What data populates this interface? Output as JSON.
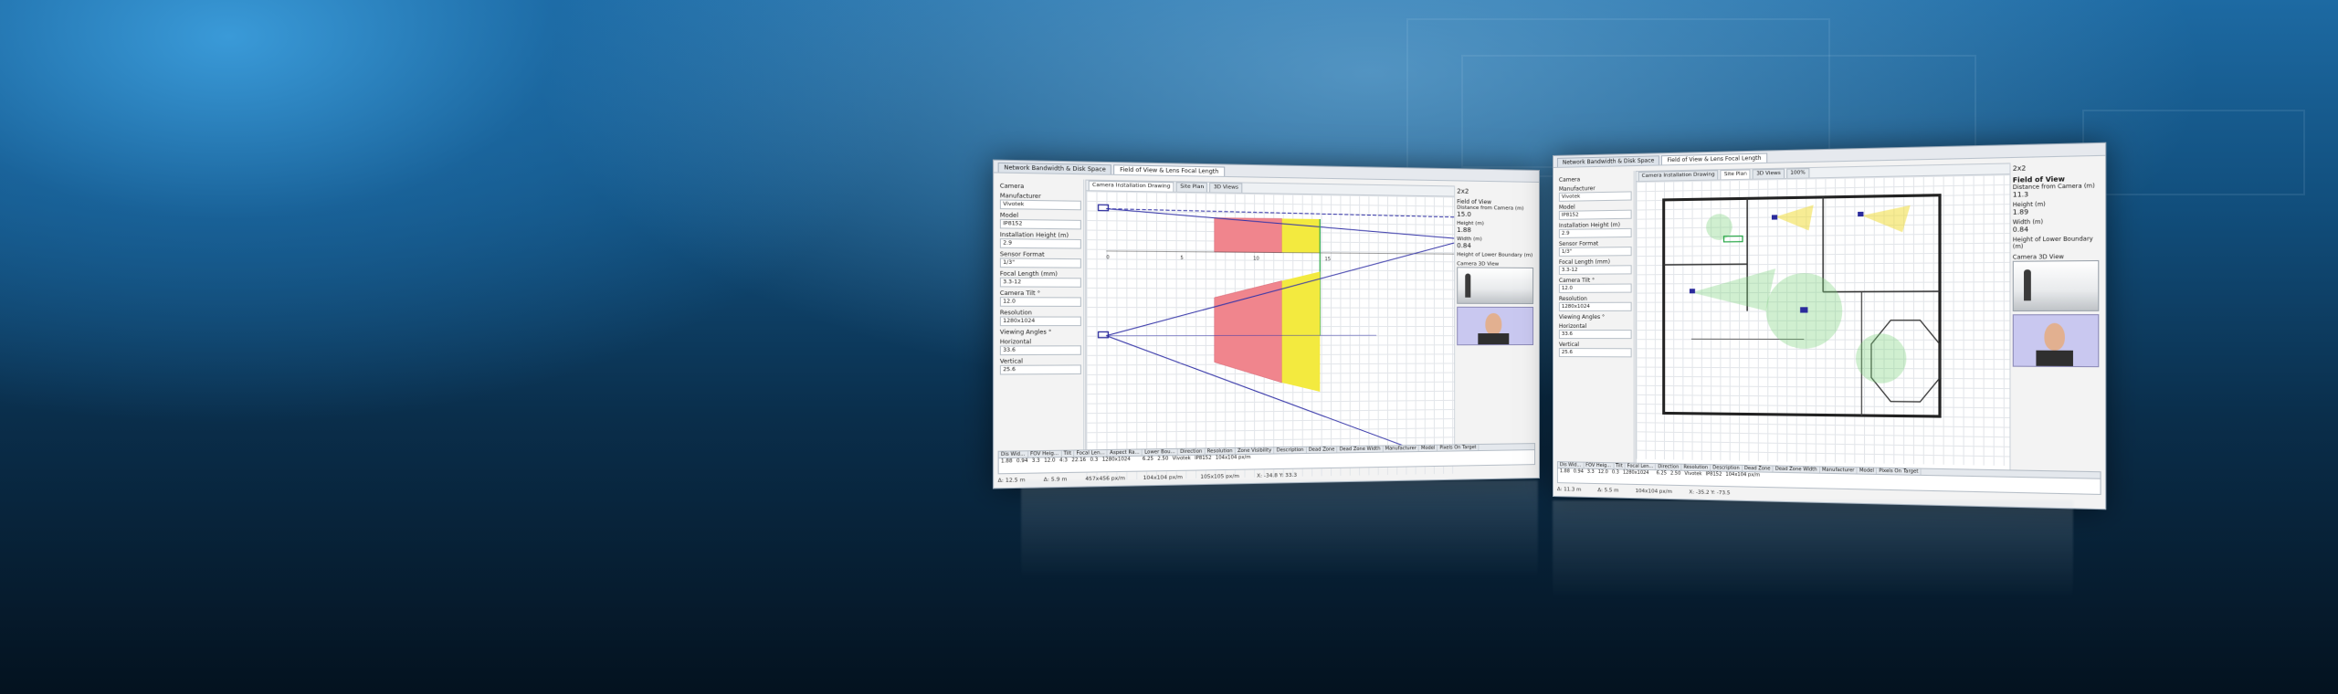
{
  "left_window": {
    "tabs": [
      "Network Bandwidth & Disk Space",
      "Field of View & Lens Focal Length"
    ],
    "subtabs": [
      "Camera Installation Drawing",
      "Site Plan",
      "3D Views"
    ],
    "side_labels": [
      "Camera",
      "Manufacturer",
      "Model",
      "Installation Height (m)",
      "Sensor Format",
      "Focal Length (mm)",
      "Camera Tilt °",
      "Resolution",
      "Viewing Angles °",
      "Horizontal",
      "Vertical"
    ],
    "side_values": [
      "Vivotek",
      "IP8152",
      "2.9",
      "1/3\"",
      "3.3-12",
      "12.0",
      "1280x1024",
      "33.6",
      "25.6"
    ],
    "right_labels": [
      "Field of View",
      "Distance from Camera (m)",
      "Height (m)",
      "Width (m)",
      "Height of Lower Boundary (m)",
      "Camera 3D View"
    ],
    "right_values": [
      "2x2",
      "15.0",
      "1.88",
      "0.84"
    ],
    "axis_ticks": [
      "0",
      "5",
      "10",
      "15"
    ],
    "table_headers": [
      "Dis Wid...",
      "FOV Heig...",
      "Tilt",
      "Focal Len...",
      "Aspect Ra...",
      "Lower Bou...",
      "Direction",
      "Resolution",
      "Zone Visibility",
      "Description",
      "Dead Zone",
      "Dead Zone Width",
      "Manufacturer",
      "Model",
      "Pixels On Target"
    ],
    "table_values": [
      "1.88",
      "0.94",
      "3.3",
      "12.0",
      "4:3",
      "22.16",
      "0.3",
      "1280x1024",
      "",
      "",
      "6.25",
      "2.50",
      "Vivotek",
      "IP8152",
      "104x104 px/m"
    ],
    "status": [
      "Δ: 12.5 m",
      "Δ: 5.9 m",
      "457x456 px/m",
      "104x104 px/m",
      "105x105 px/m",
      "X: -34.8 Y: 33.3"
    ]
  },
  "right_window": {
    "tabs": [
      "Network Bandwidth & Disk Space",
      "Field of View & Lens Focal Length"
    ],
    "subtabs": [
      "Camera Installation Drawing",
      "Site Plan",
      "3D Views"
    ],
    "toolbar_zoom": "100%",
    "side_labels": [
      "Camera",
      "Manufacturer",
      "Model",
      "Installation Height (m)",
      "Sensor Format",
      "Focal Length (mm)",
      "Camera Tilt °",
      "Resolution",
      "Viewing Angles °",
      "Horizontal",
      "Vertical"
    ],
    "side_values": [
      "Vivotek",
      "IP8152",
      "2.9",
      "1/3\"",
      "3.3-12",
      "12.0",
      "1280x1024",
      "33.6",
      "25.6"
    ],
    "right_header": "2x2",
    "right_labels": [
      "Field of View",
      "Distance from Camera (m)",
      "Height (m)",
      "Width (m)",
      "Height of Lower Boundary (m)",
      "Camera 3D View"
    ],
    "right_values": [
      "11.3",
      "1.89",
      "0.84"
    ],
    "table_headers": [
      "Dis Wid...",
      "FOV Heig...",
      "Tilt",
      "Focal Len...",
      "Direction",
      "Resolution",
      "Description",
      "Dead Zone",
      "Dead Zone Width",
      "Manufacturer",
      "Model",
      "Pixels On Target"
    ],
    "table_values": [
      "1.88",
      "0.94",
      "3.3",
      "12.0",
      "0.3",
      "1280x1024",
      "",
      "6.25",
      "2.50",
      "Vivotek",
      "IP8152",
      "104x104 px/m"
    ],
    "status": [
      "Δ: 11.3 m",
      "Δ: 5.5 m",
      "104x104 px/m",
      "X: -35.2 Y: -73.5"
    ]
  },
  "colors": {
    "red_zone": "#f0858d",
    "yellow_zone": "#f3ea3f",
    "green_line": "#2aa84a",
    "fov_line": "#3535a8"
  }
}
